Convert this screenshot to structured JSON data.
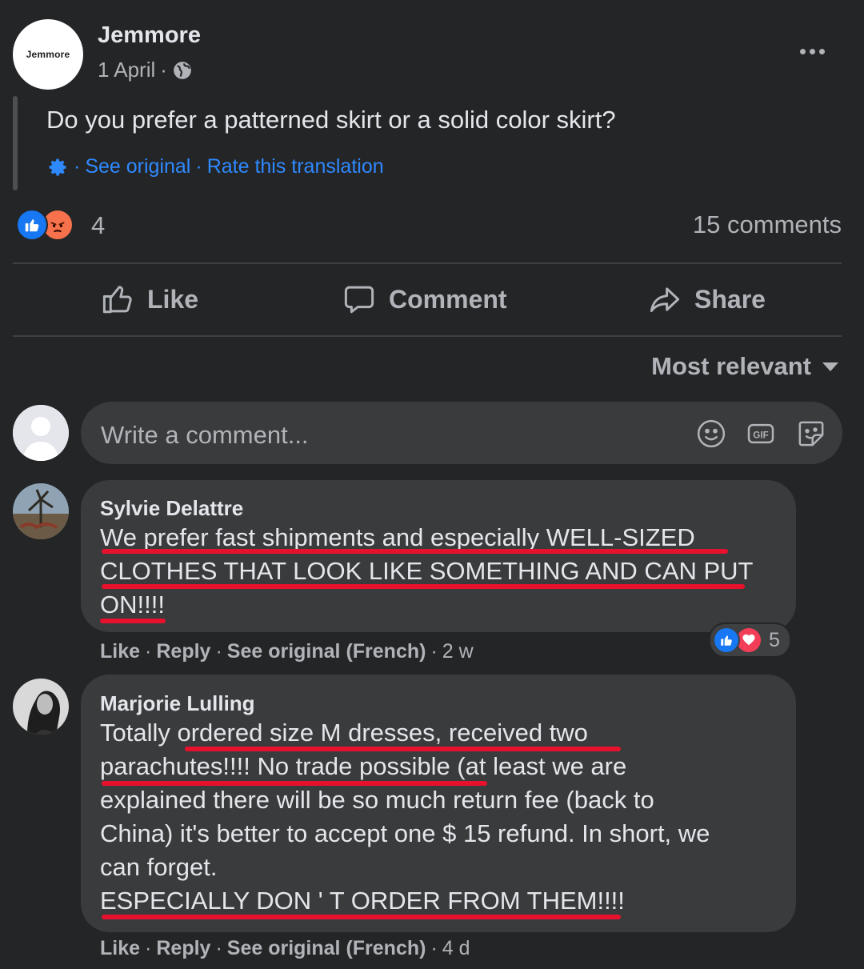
{
  "post": {
    "page_name": "Jemmore",
    "avatar_text": "Jemmore",
    "date": "1 April",
    "meta_sep": "·",
    "text": "Do you prefer a patterned skirt or a solid color skirt?",
    "translation_sep": "·",
    "see_original": "See original",
    "rate_translation": "Rate this translation",
    "reaction_count": "4",
    "reaction_icons": [
      "like-icon",
      "angry-icon"
    ],
    "comments_count": "15 comments"
  },
  "actions": {
    "like": "Like",
    "comment": "Comment",
    "share": "Share"
  },
  "sort": {
    "label": "Most relevant"
  },
  "composer": {
    "placeholder": "Write a comment...",
    "icons": [
      "emoji-icon",
      "gif-icon",
      "sticker-icon"
    ]
  },
  "comments": [
    {
      "author": "Sylvie Delattre",
      "lines": [
        "We prefer fast shipments and especially WELL-SIZED",
        "CLOTHES THAT LOOK LIKE SOMETHING AND CAN PUT",
        "ON!!!!"
      ],
      "like": "Like",
      "reply": "Reply",
      "see_original": "See original (French)",
      "time": "2 w",
      "sep": "·",
      "reaction_count": "5",
      "reaction_icons": [
        "like-icon",
        "love-icon"
      ]
    },
    {
      "author": "Marjorie Lulling",
      "lines": [
        "Totally ordered size M dresses, received two",
        "parachutes!!!! No trade possible (at least we are",
        "explained there will be so much return fee (back to",
        "China) it's better to accept one $ 15 refund. In short, we",
        "can forget.",
        "ESPECIALLY DON ' T ORDER FROM THEM!!!!"
      ],
      "like": "Like",
      "reply": "Reply",
      "see_original": "See original (French)",
      "time": "4 d",
      "sep": "·"
    }
  ],
  "colors": {
    "background": "#242526",
    "bubble": "#3a3b3c",
    "link": "#2e89ff",
    "underline": "#e8112d",
    "like_blue": "#1877f2",
    "love_red": "#f33e58",
    "angry_orange": "#f7714c"
  }
}
